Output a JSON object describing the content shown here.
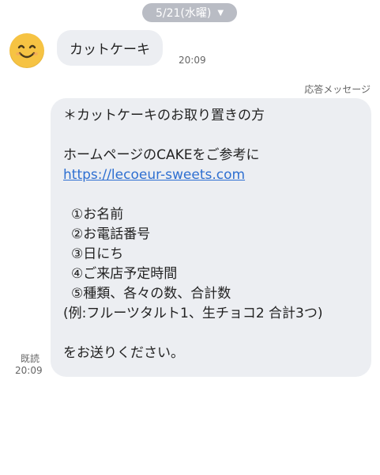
{
  "header": {
    "date_label": "5/21(水曜)",
    "dropdown_icon": "chevron-down-icon"
  },
  "incoming": {
    "avatar_icon": "smiling-face-icon",
    "text": "カットケーキ",
    "time": "20:09"
  },
  "reply": {
    "label": "応答メッセージ",
    "lines": {
      "title": "＊カットケーキのお取り置きの方",
      "homepage": "ホームページのCAKEをご参考に",
      "url": "https://lecoeur-sweets.com",
      "item1": "①お名前",
      "item2": "②お電話番号",
      "item3": "③日にち",
      "item4": "④ご来店予定時間",
      "item5": "⑤種類、各々の数、合計数",
      "example": "(例:フルーツタルト1、生チョコ2 合計3つ)",
      "closing": "をお送りください。"
    },
    "read_label": "既読",
    "time": "20:09"
  },
  "colors": {
    "bubble": "#eceef2",
    "link": "#2e6fd1",
    "date_pill": "#b9bcc4"
  }
}
